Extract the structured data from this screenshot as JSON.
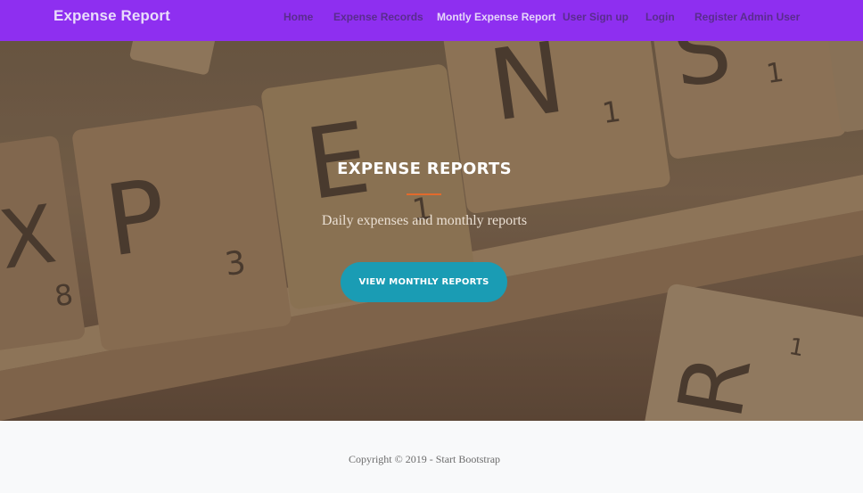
{
  "navbar": {
    "brand": "Expense Report",
    "links": [
      {
        "label": "Home"
      },
      {
        "label": "Expense Records"
      },
      {
        "label": "Montly Expense Report"
      },
      {
        "label": "User Sign up"
      },
      {
        "label": "Login"
      },
      {
        "label": "Register Admin User"
      }
    ]
  },
  "hero": {
    "title": "EXPENSE REPORTS",
    "subtitle": "Daily expenses and monthly reports",
    "button_label": "VIEW MONTHLY REPORTS",
    "tiles": [
      {
        "letter": "X",
        "value": "8"
      },
      {
        "letter": "P",
        "value": "3"
      },
      {
        "letter": "E",
        "value": "1"
      },
      {
        "letter": "N",
        "value": "1"
      },
      {
        "letter": "S",
        "value": "1"
      },
      {
        "letter": "R",
        "value": "1"
      }
    ]
  },
  "footer": {
    "copyright": "Copyright © 2019 - Start Bootstrap"
  },
  "colors": {
    "navbar": "#8e2ff0",
    "accent_divider": "#e26a2c",
    "button": "#1a9cb4"
  }
}
